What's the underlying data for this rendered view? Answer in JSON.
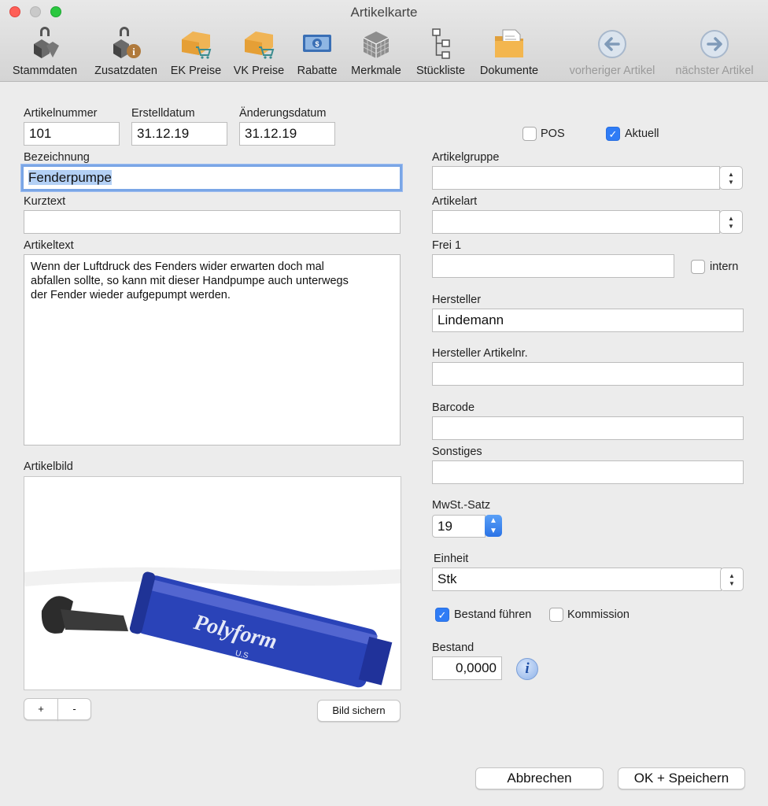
{
  "window": {
    "title": "Artikelkarte"
  },
  "toolbar": {
    "items": [
      {
        "label": "Stammdaten",
        "icon": "cubes-icon"
      },
      {
        "label": "Zusatzdaten",
        "icon": "cube-info-icon"
      },
      {
        "label": "EK Preise",
        "icon": "price-cart-icon"
      },
      {
        "label": "VK Preise",
        "icon": "price-cart-icon"
      },
      {
        "label": "Rabatte",
        "icon": "banknote-icon"
      },
      {
        "label": "Merkmale",
        "icon": "grid-cube-icon"
      },
      {
        "label": "Stückliste",
        "icon": "tree-icon"
      },
      {
        "label": "Dokumente",
        "icon": "folder-document-icon"
      },
      {
        "label": "vorheriger Artikel",
        "icon": "arrow-left-circle-icon"
      },
      {
        "label": "nächster Artikel",
        "icon": "arrow-right-circle-icon"
      }
    ]
  },
  "form": {
    "artikelnummer": {
      "label": "Artikelnummer",
      "value": "101"
    },
    "erstelldatum": {
      "label": "Erstelldatum",
      "value": "31.12.19"
    },
    "aenderungsdatum": {
      "label": "Änderungsdatum",
      "value": "31.12.19"
    },
    "bezeichnung": {
      "label": "Bezeichnung",
      "value": "Fenderpumpe"
    },
    "kurztext": {
      "label": "Kurztext",
      "value": ""
    },
    "artikeltext": {
      "label": "Artikeltext",
      "value": "Wenn der Luftdruck des Fenders wider erwarten doch mal\nabfallen sollte, so kann mit dieser Handpumpe auch unterwegs\nder Fender wieder aufgepumpt werden."
    },
    "artikelbild": {
      "label": "Artikelbild",
      "image_text": "Polyform",
      "image_subtext": "U.S"
    },
    "image_add": "+",
    "image_remove": "-",
    "bild_sichern": "Bild sichern",
    "pos": {
      "label": "POS",
      "checked": false
    },
    "aktuell": {
      "label": "Aktuell",
      "checked": true
    },
    "artikelgruppe": {
      "label": "Artikelgruppe",
      "value": ""
    },
    "artikelart": {
      "label": "Artikelart",
      "value": ""
    },
    "frei1": {
      "label": "Frei 1",
      "value": ""
    },
    "intern": {
      "label": "intern",
      "checked": false
    },
    "hersteller": {
      "label": "Hersteller",
      "value": "Lindemann"
    },
    "hersteller_artikelnr": {
      "label": "Hersteller Artikelnr.",
      "value": ""
    },
    "barcode": {
      "label": "Barcode",
      "value": ""
    },
    "sonstiges": {
      "label": "Sonstiges",
      "value": ""
    },
    "mwst": {
      "label": "MwSt.-Satz",
      "value": "19"
    },
    "einheit": {
      "label": "Einheit",
      "value": "Stk"
    },
    "bestand_fuehren": {
      "label": "Bestand führen",
      "checked": true
    },
    "kommission": {
      "label": "Kommission",
      "checked": false
    },
    "bestand": {
      "label": "Bestand",
      "value": "0,0000"
    }
  },
  "buttons": {
    "cancel": "Abbrechen",
    "ok": "OK + Speichern"
  },
  "colors": {
    "accent": "#2f7cf6",
    "focus": "#7aa6e6",
    "product": "#2a43b8"
  }
}
